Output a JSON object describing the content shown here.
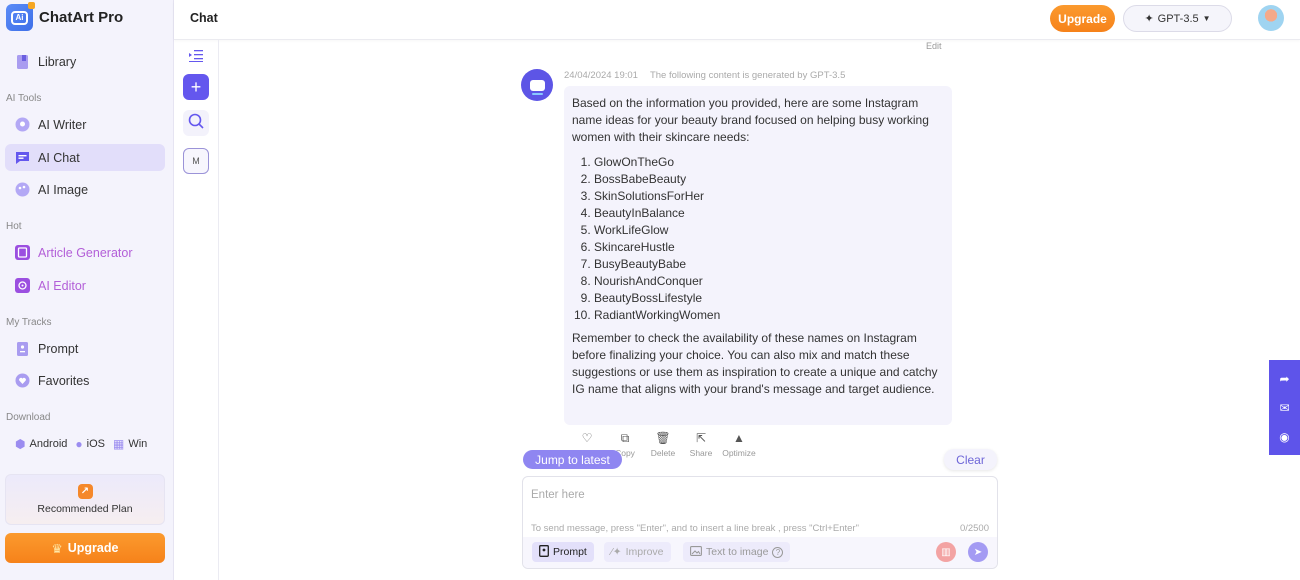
{
  "app": {
    "name": "ChatArt Pro"
  },
  "sidebar": {
    "library": "Library",
    "sections": {
      "ai_tools": "AI Tools",
      "hot": "Hot",
      "my_tracks": "My Tracks",
      "download": "Download"
    },
    "ai_tools": [
      {
        "label": "AI Writer",
        "icon": "bulb-icon"
      },
      {
        "label": "AI Chat",
        "icon": "chat-icon",
        "active": true
      },
      {
        "label": "AI Image",
        "icon": "palette-icon"
      }
    ],
    "hot": [
      {
        "label": "Article Generator",
        "icon": "edit-doc-icon"
      },
      {
        "label": "AI Editor",
        "icon": "flower-icon"
      }
    ],
    "my_tracks": [
      {
        "label": "Prompt",
        "icon": "bookmark-icon"
      },
      {
        "label": "Favorites",
        "icon": "heart-icon"
      }
    ],
    "downloads": [
      {
        "label": "Android",
        "icon": "android-icon"
      },
      {
        "label": "iOS",
        "icon": "apple-icon"
      },
      {
        "label": "Win",
        "icon": "windows-icon"
      }
    ],
    "recommended_plan": "Recommended Plan",
    "upgrade": "Upgrade"
  },
  "rail": {
    "m_label": "M"
  },
  "header": {
    "title": "Chat",
    "upgrade": "Upgrade",
    "model": "GPT-3.5"
  },
  "chat": {
    "edit": "Edit",
    "timestamp": "24/04/2024 19:01",
    "generated_by": "The following content is generated by GPT-3.5",
    "intro": "Based on the information you provided, here are some Instagram name ideas for your beauty brand focused on helping busy working women with their skincare needs:",
    "names": [
      "GlowOnTheGo",
      "BossBabeBeauty",
      "SkinSolutionsForHer",
      "BeautyInBalance",
      "WorkLifeGlow",
      "SkincareHustle",
      "BusyBeautyBabe",
      "NourishAndConquer",
      "BeautyBossLifestyle",
      "RadiantWorkingWomen"
    ],
    "outro": "Remember to check the availability of these names on Instagram before finalizing your choice. You can also mix and match these suggestions or use them as inspiration to create a unique and catchy IG name that aligns with your brand's message and target audience.",
    "actions": [
      "Favorite",
      "Copy",
      "Delete",
      "Share",
      "Optimize"
    ],
    "jump_to_latest": "Jump to latest",
    "clear": "Clear"
  },
  "composer": {
    "placeholder": "Enter here",
    "value": "",
    "hint": "To send message, press \"Enter\", and to insert a line break , press \"Ctrl+Enter\"",
    "count": "0/2500",
    "prompt": "Prompt",
    "improve": "Improve",
    "text_to_image": "Text to image"
  },
  "colors": {
    "accent": "#6457ee",
    "upgrade": "#f6821a",
    "sidebar_bg": "#f4f3fc"
  }
}
